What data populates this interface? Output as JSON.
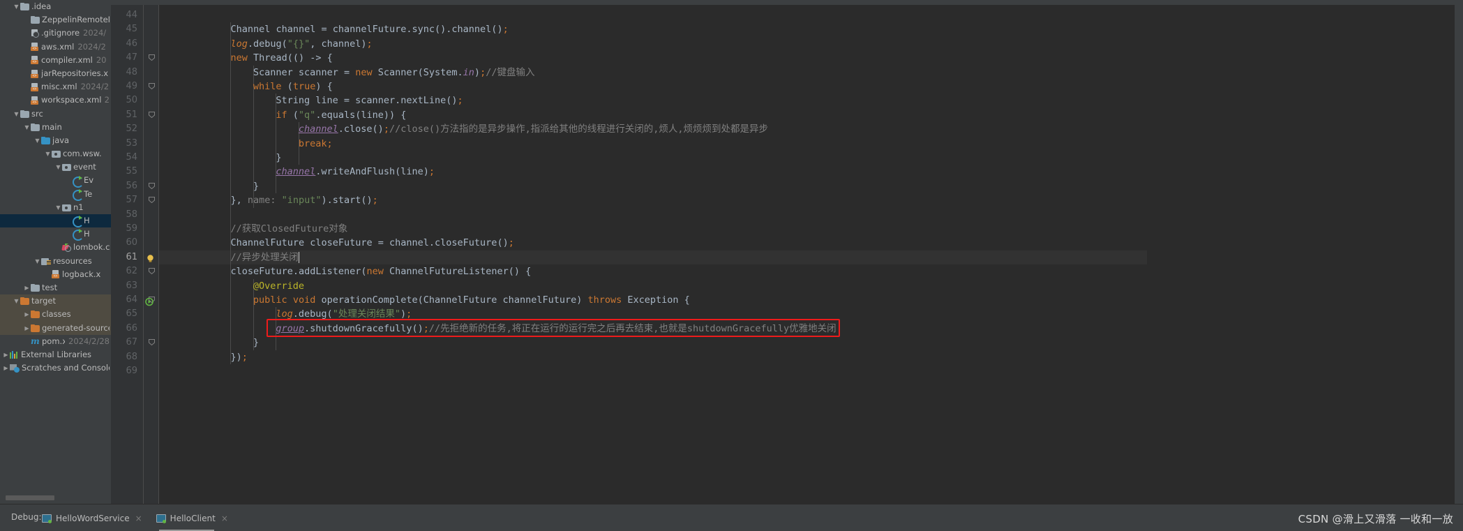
{
  "sidebar": {
    "items": [
      {
        "indent": 1,
        "arrow": "down",
        "icon": "folder-icon",
        "label": ".idea",
        "date": ""
      },
      {
        "indent": 2,
        "arrow": "none",
        "icon": "folder-icon",
        "label": "ZeppelinRemoteN",
        "date": ""
      },
      {
        "indent": 2,
        "arrow": "none",
        "icon": "gitignore-file-icon",
        "label": ".gitignore",
        "date": "2024/"
      },
      {
        "indent": 2,
        "arrow": "none",
        "icon": "xml-file-icon",
        "label": "aws.xml",
        "date": "2024/2"
      },
      {
        "indent": 2,
        "arrow": "none",
        "icon": "xml-file-icon",
        "label": "compiler.xml",
        "date": "20"
      },
      {
        "indent": 2,
        "arrow": "none",
        "icon": "xml-file-icon",
        "label": "jarRepositories.x",
        "date": ""
      },
      {
        "indent": 2,
        "arrow": "none",
        "icon": "xml-file-icon",
        "label": "misc.xml",
        "date": "2024/2"
      },
      {
        "indent": 2,
        "arrow": "none",
        "icon": "xml-file-icon",
        "label": "workspace.xml",
        "date": "2"
      },
      {
        "indent": 1,
        "arrow": "down",
        "icon": "folder-icon",
        "label": "src",
        "date": ""
      },
      {
        "indent": 2,
        "arrow": "down",
        "icon": "folder-icon",
        "label": "main",
        "date": ""
      },
      {
        "indent": 3,
        "arrow": "down",
        "icon": "source-folder-icon",
        "label": "java",
        "date": ""
      },
      {
        "indent": 4,
        "arrow": "down",
        "icon": "package-icon",
        "label": "com.wsw.",
        "date": ""
      },
      {
        "indent": 5,
        "arrow": "down",
        "icon": "package-icon",
        "label": "event",
        "date": ""
      },
      {
        "indent": 6,
        "arrow": "none",
        "icon": "java-class-icon",
        "label": "Ev",
        "date": ""
      },
      {
        "indent": 6,
        "arrow": "none",
        "icon": "java-class-icon",
        "label": "Te",
        "date": ""
      },
      {
        "indent": 5,
        "arrow": "down",
        "icon": "package-icon",
        "label": "n1",
        "date": ""
      },
      {
        "indent": 6,
        "arrow": "none",
        "icon": "java-class-icon",
        "label": "H",
        "date": "",
        "selected": true
      },
      {
        "indent": 6,
        "arrow": "none",
        "icon": "java-class-icon",
        "label": "H",
        "date": ""
      },
      {
        "indent": 5,
        "arrow": "none",
        "icon": "lombok-config-icon",
        "label": "lombok.c",
        "date": ""
      },
      {
        "indent": 3,
        "arrow": "down",
        "icon": "resources-folder-icon",
        "label": "resources",
        "date": ""
      },
      {
        "indent": 4,
        "arrow": "none",
        "icon": "xml-file-icon",
        "label": "logback.x",
        "date": ""
      },
      {
        "indent": 2,
        "arrow": "right",
        "icon": "folder-icon",
        "label": "test",
        "date": ""
      },
      {
        "indent": 1,
        "arrow": "down",
        "icon": "excluded-folder-icon",
        "label": "target",
        "date": "",
        "excluded": true
      },
      {
        "indent": 2,
        "arrow": "right",
        "icon": "excluded-folder-icon",
        "label": "classes",
        "date": "",
        "excluded": true
      },
      {
        "indent": 2,
        "arrow": "right",
        "icon": "excluded-folder-icon",
        "label": "generated-source",
        "date": "",
        "excluded": true
      },
      {
        "indent": 2,
        "arrow": "none",
        "icon": "maven-pom-icon",
        "label": "pom.xml",
        "date": "2024/2/28"
      },
      {
        "indent": 0,
        "arrow": "right",
        "icon": "external-libraries-icon",
        "label": "External Libraries",
        "date": ""
      },
      {
        "indent": 0,
        "arrow": "right",
        "icon": "scratches-icon",
        "label": "Scratches and Consoles",
        "date": ""
      }
    ]
  },
  "editor": {
    "first_line_number": 44,
    "last_line_number": 69,
    "current_line": 61,
    "line_numbers": [
      44,
      45,
      46,
      47,
      48,
      49,
      50,
      51,
      52,
      53,
      54,
      55,
      56,
      57,
      58,
      59,
      60,
      61,
      62,
      63,
      64,
      65,
      66,
      67,
      68,
      69
    ],
    "lines": [
      {
        "n": 44,
        "indent": 0,
        "tokens": []
      },
      {
        "n": 45,
        "indent": 12,
        "tokens": [
          {
            "t": "Channel channel = channelFuture.sync().channel()",
            "c": "pl"
          },
          {
            "t": ";",
            "c": "sm"
          }
        ]
      },
      {
        "n": 46,
        "indent": 12,
        "tokens": [
          {
            "t": "log",
            "c": "kf"
          },
          {
            "t": ".debug(",
            "c": "pl"
          },
          {
            "t": "\"{}\"",
            "c": "s"
          },
          {
            "t": ", channel)",
            "c": "pl"
          },
          {
            "t": ";",
            "c": "sm"
          }
        ]
      },
      {
        "n": 47,
        "indent": 12,
        "tokens": [
          {
            "t": "new",
            "c": "k"
          },
          {
            "t": " Thread(() -> {",
            "c": "pl"
          }
        ]
      },
      {
        "n": 48,
        "indent": 16,
        "tokens": [
          {
            "t": "Scanner scanner = ",
            "c": "pl"
          },
          {
            "t": "new",
            "c": "k"
          },
          {
            "t": " Scanner(System.",
            "c": "pl"
          },
          {
            "t": "in",
            "c": "fl"
          },
          {
            "t": ")",
            "c": "pl"
          },
          {
            "t": ";",
            "c": "sm"
          },
          {
            "t": "//键盘输入",
            "c": "cm"
          }
        ]
      },
      {
        "n": 49,
        "indent": 16,
        "tokens": [
          {
            "t": "while",
            "c": "k"
          },
          {
            "t": " (",
            "c": "pl"
          },
          {
            "t": "true",
            "c": "k"
          },
          {
            "t": ") {",
            "c": "pl"
          }
        ]
      },
      {
        "n": 50,
        "indent": 20,
        "tokens": [
          {
            "t": "String line = scanner.nextLine()",
            "c": "pl"
          },
          {
            "t": ";",
            "c": "sm"
          }
        ]
      },
      {
        "n": 51,
        "indent": 20,
        "tokens": [
          {
            "t": "if",
            "c": "k"
          },
          {
            "t": " (",
            "c": "pl"
          },
          {
            "t": "\"q\"",
            "c": "s"
          },
          {
            "t": ".equals(line)) {",
            "c": "pl"
          }
        ]
      },
      {
        "n": 52,
        "indent": 24,
        "tokens": [
          {
            "t": "channel",
            "c": "fl un"
          },
          {
            "t": ".close()",
            "c": "pl"
          },
          {
            "t": ";",
            "c": "sm"
          },
          {
            "t": "//close()方法指的是异步操作,指派给其他的线程进行关闭的,烦人,烦烦烦到处都是异步",
            "c": "cm"
          }
        ]
      },
      {
        "n": 53,
        "indent": 24,
        "tokens": [
          {
            "t": "break",
            "c": "k"
          },
          {
            "t": ";",
            "c": "sm"
          }
        ]
      },
      {
        "n": 54,
        "indent": 20,
        "tokens": [
          {
            "t": "}",
            "c": "pl"
          }
        ]
      },
      {
        "n": 55,
        "indent": 20,
        "tokens": [
          {
            "t": "channel",
            "c": "fl un"
          },
          {
            "t": ".writeAndFlush(line)",
            "c": "pl"
          },
          {
            "t": ";",
            "c": "sm"
          }
        ]
      },
      {
        "n": 56,
        "indent": 16,
        "tokens": [
          {
            "t": "}",
            "c": "pl"
          }
        ]
      },
      {
        "n": 57,
        "indent": 12,
        "tokens": [
          {
            "t": "}, ",
            "c": "pl"
          },
          {
            "t": "name:",
            "c": "cm"
          },
          {
            "t": " ",
            "c": "pl"
          },
          {
            "t": "\"input\"",
            "c": "s"
          },
          {
            "t": ").start()",
            "c": "pl"
          },
          {
            "t": ";",
            "c": "sm"
          }
        ]
      },
      {
        "n": 58,
        "indent": 0,
        "tokens": []
      },
      {
        "n": 59,
        "indent": 12,
        "tokens": [
          {
            "t": "//获取ClosedFuture对象",
            "c": "cm"
          }
        ]
      },
      {
        "n": 60,
        "indent": 12,
        "tokens": [
          {
            "t": "ChannelFuture closeFuture = channel.closeFuture()",
            "c": "pl"
          },
          {
            "t": ";",
            "c": "sm"
          }
        ]
      },
      {
        "n": 61,
        "indent": 12,
        "tokens": [
          {
            "t": "//异步处理关闭",
            "c": "cm"
          }
        ],
        "caret": true
      },
      {
        "n": 62,
        "indent": 12,
        "tokens": [
          {
            "t": "closeFuture.addListener(",
            "c": "pl"
          },
          {
            "t": "new",
            "c": "k"
          },
          {
            "t": " ChannelFutureListener() {",
            "c": "pl"
          }
        ]
      },
      {
        "n": 63,
        "indent": 16,
        "tokens": [
          {
            "t": "@Override",
            "c": "an"
          }
        ]
      },
      {
        "n": 64,
        "indent": 16,
        "tokens": [
          {
            "t": "public",
            "c": "k"
          },
          {
            "t": " ",
            "c": "pl"
          },
          {
            "t": "void",
            "c": "k"
          },
          {
            "t": " operationComplete(ChannelFuture channelFuture) ",
            "c": "pl"
          },
          {
            "t": "throws",
            "c": "k"
          },
          {
            "t": " Exception {",
            "c": "pl"
          }
        ]
      },
      {
        "n": 65,
        "indent": 20,
        "tokens": [
          {
            "t": "log",
            "c": "kf"
          },
          {
            "t": ".debug(",
            "c": "pl"
          },
          {
            "t": "\"处理关闭结果\"",
            "c": "s"
          },
          {
            "t": ")",
            "c": "pl"
          },
          {
            "t": ";",
            "c": "sm"
          }
        ]
      },
      {
        "n": 66,
        "indent": 20,
        "tokens": [
          {
            "t": "group",
            "c": "fl un"
          },
          {
            "t": ".shutdownGracefully()",
            "c": "pl"
          },
          {
            "t": ";",
            "c": "sm"
          },
          {
            "t": "//先拒绝新的任务,将正在运行的运行完之后再去结束,也就是shutdownGracefully优雅地关闭",
            "c": "cm"
          }
        ],
        "highlighted": true
      },
      {
        "n": 67,
        "indent": 16,
        "tokens": [
          {
            "t": "}",
            "c": "pl"
          }
        ]
      },
      {
        "n": 68,
        "indent": 12,
        "tokens": [
          {
            "t": "})",
            "c": "pl"
          },
          {
            "t": ";",
            "c": "sm"
          }
        ]
      },
      {
        "n": 69,
        "indent": 0,
        "tokens": []
      }
    ],
    "annotation_box_color": "#ee1b1b"
  },
  "bottom": {
    "debug_label": "Debug:",
    "tabs": [
      {
        "label": "HelloWordService",
        "active": false,
        "close": "×"
      },
      {
        "label": "HelloClient",
        "active": true,
        "close": "×"
      }
    ],
    "watermark": "CSDN @滑上又滑落 一收和一放"
  }
}
